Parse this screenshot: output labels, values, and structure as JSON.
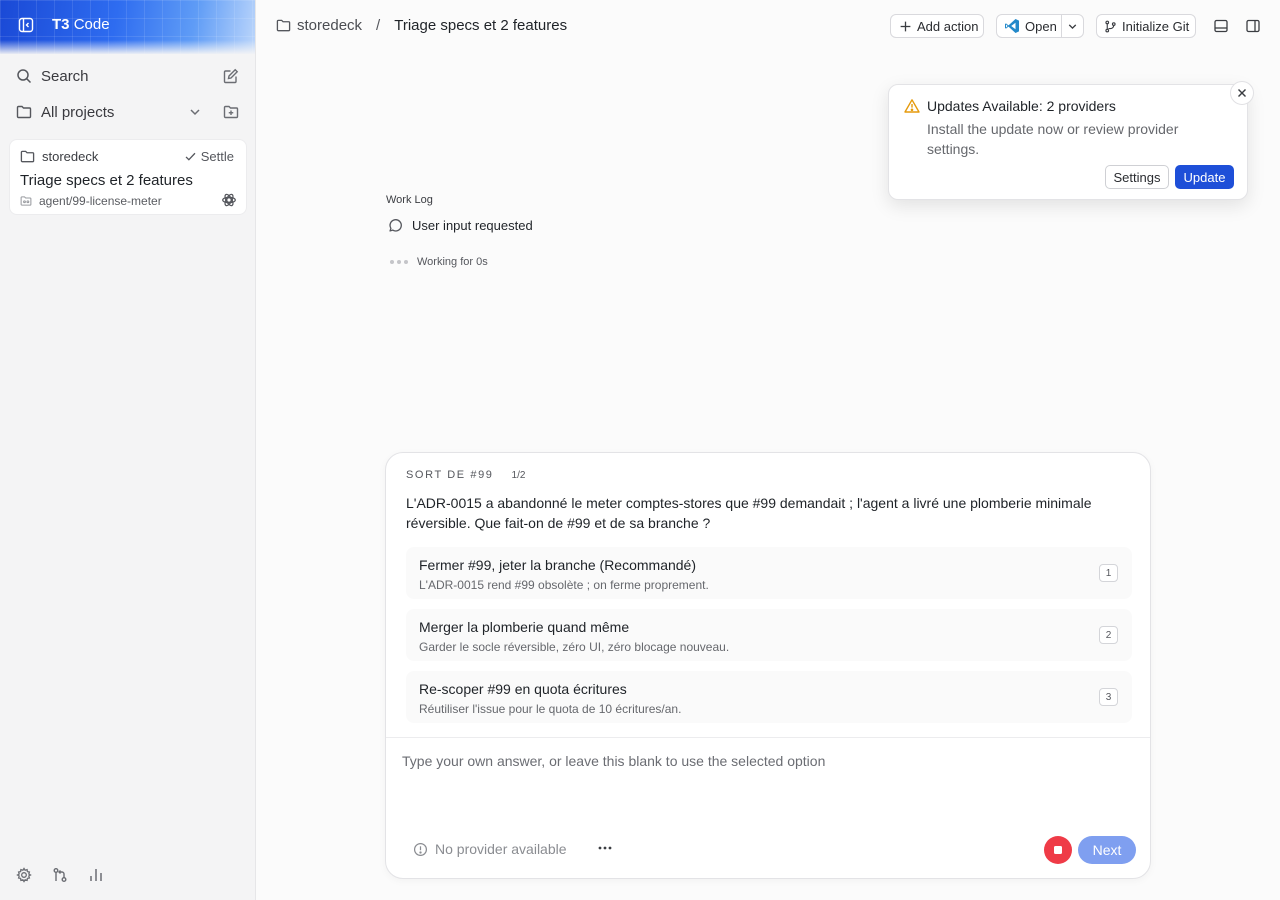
{
  "app": {
    "name_bold": "T3",
    "name_rest": "Code"
  },
  "sidebar": {
    "search_label": "Search",
    "projects_label": "All projects",
    "thread": {
      "project": "storedeck",
      "status": "Settle",
      "title": "Triage specs et 2 features",
      "branch": "agent/99-license-meter"
    }
  },
  "header": {
    "project": "storedeck",
    "separator": "/",
    "title": "Triage specs et 2 features",
    "add_action": "Add action",
    "open": "Open",
    "init_git": "Initialize Git"
  },
  "toast": {
    "title": "Updates Available: 2 providers",
    "body": "Install the update now or review provider settings.",
    "settings": "Settings",
    "update": "Update"
  },
  "worklog": {
    "label": "Work Log",
    "item": "User input requested",
    "working": "Working for 0s"
  },
  "question": {
    "tag": "SORT DE #99",
    "count": "1/2",
    "text": "L'ADR-0015 a abandonné le meter comptes-stores que #99 demandait ; l'agent a livré une plomberie minimale réversible. Que fait-on de #99 et de sa branche ?",
    "options": [
      {
        "title": "Fermer #99, jeter la branche (Recommandé)",
        "desc": "L'ADR-0015 rend #99 obsolète ; on ferme proprement.",
        "key": "1"
      },
      {
        "title": "Merger la plomberie quand même",
        "desc": "Garder le socle réversible, zéro UI, zéro blocage nouveau.",
        "key": "2"
      },
      {
        "title": "Re-scoper #99 en quota écritures",
        "desc": "Réutiliser l'issue pour le quota de 10 écritures/an.",
        "key": "3"
      }
    ],
    "answer_placeholder": "Type your own answer, or leave this blank to use the selected option",
    "provider": "No provider available",
    "next": "Next"
  },
  "colors": {
    "brand": "#2e6cf0",
    "update_button": "#1e4fd8",
    "stop_button": "#ef3b47",
    "next_button": "#7f9ff0",
    "warning": "#e59a0c"
  }
}
